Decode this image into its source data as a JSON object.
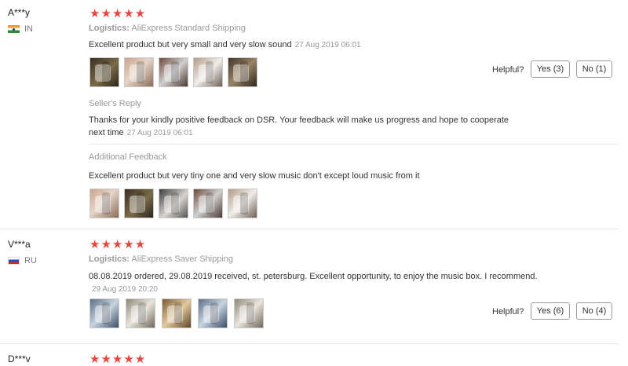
{
  "reviews": [
    {
      "user": "A***y",
      "country": "IN",
      "rating": "★★★★★",
      "logistics_label": "Logistics:",
      "logistics_value": "AliExpress Standard Shipping",
      "text": "Excellent product but very small and very slow sound",
      "date": "27 Aug 2019 06:01",
      "photos": [
        "photo-1",
        "photo-2",
        "photo-3",
        "photo-4",
        "photo-5"
      ],
      "helpful_label": "Helpful?",
      "yes_label": "Yes (3)",
      "no_label": "No (1)",
      "seller_reply": {
        "title": "Seller's Reply",
        "text_line1": "Thanks for your kindly positive feedback on DSR. Your feedback will make us progress and hope to cooperate",
        "text_line2": "next time",
        "date": "27 Aug 2019 06:01"
      },
      "additional_feedback": {
        "title": "Additional Feedback",
        "text": "Excellent product but very tiny one and very slow music don't except loud music from it",
        "photos": [
          "photo-1",
          "photo-2",
          "photo-3",
          "photo-4",
          "photo-5"
        ]
      }
    },
    {
      "user": "V***a",
      "country": "RU",
      "rating": "★★★★★",
      "logistics_label": "Logistics:",
      "logistics_value": "AliExpress Saver Shipping",
      "text": "08.08.2019 ordered, 29.08.2019 received, st. petersburg. Excellent opportunity, to enjoy the music box. I recommend.",
      "date": "29 Aug 2019 20:20",
      "photos": [
        "photo-1",
        "photo-2",
        "photo-3",
        "photo-4",
        "photo-5"
      ],
      "helpful_label": "Helpful?",
      "yes_label": "Yes (6)",
      "no_label": "No (4)"
    },
    {
      "user": "D***v",
      "rating": "★★★★★"
    }
  ],
  "colors": {
    "star": "#e8473f",
    "muted": "#999999",
    "text": "#333333"
  }
}
